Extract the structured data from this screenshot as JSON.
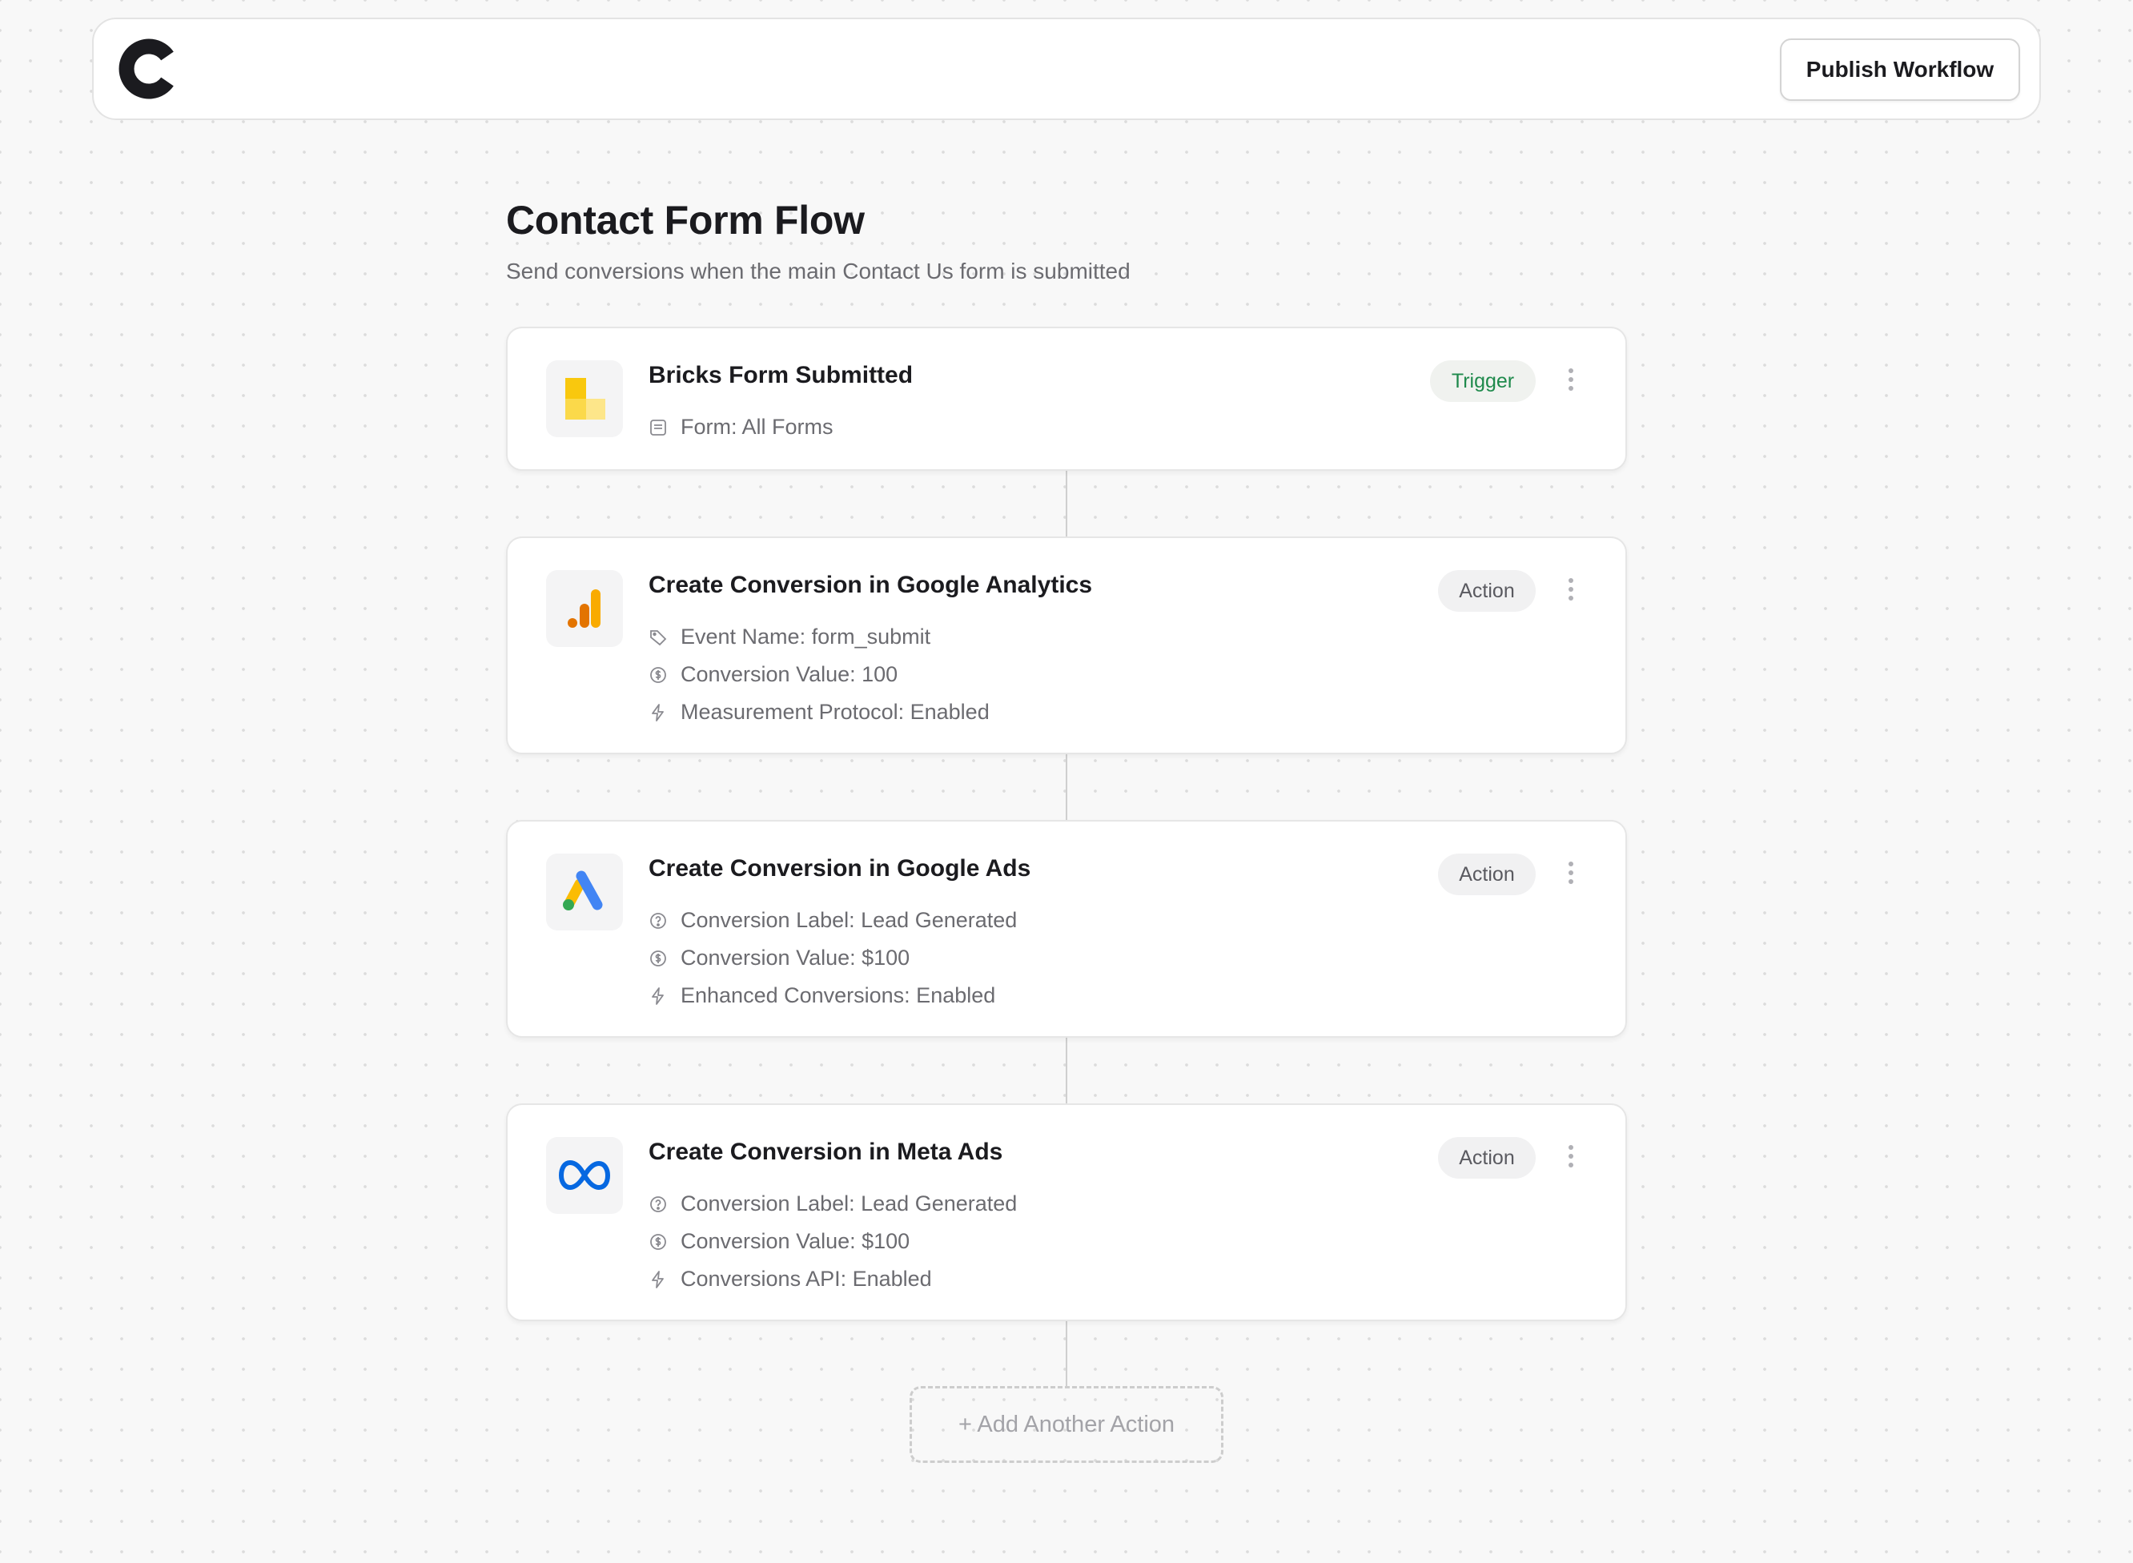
{
  "header": {
    "logo": "c-logo",
    "publish_label": "Publish Workflow"
  },
  "page": {
    "title": "Contact Form Flow",
    "subtitle": "Send conversions when the main Contact Us form is submitted"
  },
  "steps": [
    {
      "title": "Bricks Form Submitted",
      "badge": "Trigger",
      "icon": "bricks-icon",
      "details": [
        {
          "icon": "form-icon",
          "text": "Form: All Forms"
        }
      ]
    },
    {
      "title": "Create Conversion in Google Analytics",
      "badge": "Action",
      "icon": "google-analytics-icon",
      "details": [
        {
          "icon": "tag-icon",
          "text": "Event Name: form_submit"
        },
        {
          "icon": "dollar-icon",
          "text": "Conversion Value: 100"
        },
        {
          "icon": "bolt-icon",
          "text": "Measurement Protocol: Enabled"
        }
      ]
    },
    {
      "title": "Create Conversion in Google Ads",
      "badge": "Action",
      "icon": "google-ads-icon",
      "details": [
        {
          "icon": "question-icon",
          "text": "Conversion Label: Lead Generated"
        },
        {
          "icon": "dollar-icon",
          "text": "Conversion Value: $100"
        },
        {
          "icon": "bolt-icon",
          "text": "Enhanced Conversions: Enabled"
        }
      ]
    },
    {
      "title": "Create Conversion in Meta Ads",
      "badge": "Action",
      "icon": "meta-icon",
      "details": [
        {
          "icon": "question-icon",
          "text": "Conversion Label: Lead Generated"
        },
        {
          "icon": "dollar-icon",
          "text": "Conversion Value: $100"
        },
        {
          "icon": "bolt-icon",
          "text": "Conversions API: Enabled"
        }
      ]
    }
  ],
  "add_action_label": "+ Add Another Action",
  "colors": {
    "trigger_text": "#1f8a4c",
    "meta_blue": "#0668e1",
    "ga_orange": "#f9ab00",
    "ads_blue": "#4285f4",
    "ads_yellow": "#fbbc04",
    "ads_green": "#34a853"
  }
}
